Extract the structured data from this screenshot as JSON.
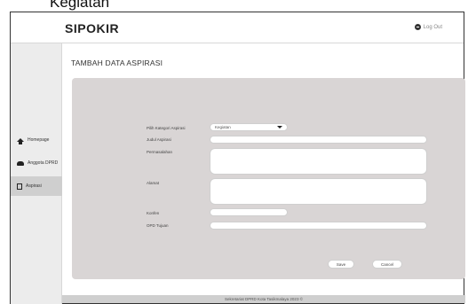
{
  "caption": "Kegiatan",
  "header": {
    "brand": "SIPOKIR",
    "logout_label": "Log Out"
  },
  "sidebar": {
    "items": [
      {
        "label": "Homepage",
        "icon": "home-icon"
      },
      {
        "label": "Anggota DPRD",
        "icon": "group-icon"
      },
      {
        "label": "Aspirasi",
        "icon": "document-icon",
        "active": true
      }
    ]
  },
  "main": {
    "title": "TAMBAH DATA ASPIRASI"
  },
  "form": {
    "kategori_label": "Pilih Kategori Aspirasi",
    "kategori_value": "Kegiatan",
    "judul_label": "Judul Aspirasi",
    "judul_value": "",
    "permasalahan_label": "Permasalahan",
    "permasalahan_value": "",
    "alamat_label": "Alamat",
    "alamat_value": "",
    "konfen_label": "Konfen",
    "konfen_value": "",
    "opd_label": "OPD Tujuan",
    "opd_value": ""
  },
  "actions": {
    "save_label": "Save",
    "cancel_label": "Cancel"
  },
  "footer": {
    "text": "Sekretariat DPRD Kota Tasikmalaya 2023 ©"
  }
}
